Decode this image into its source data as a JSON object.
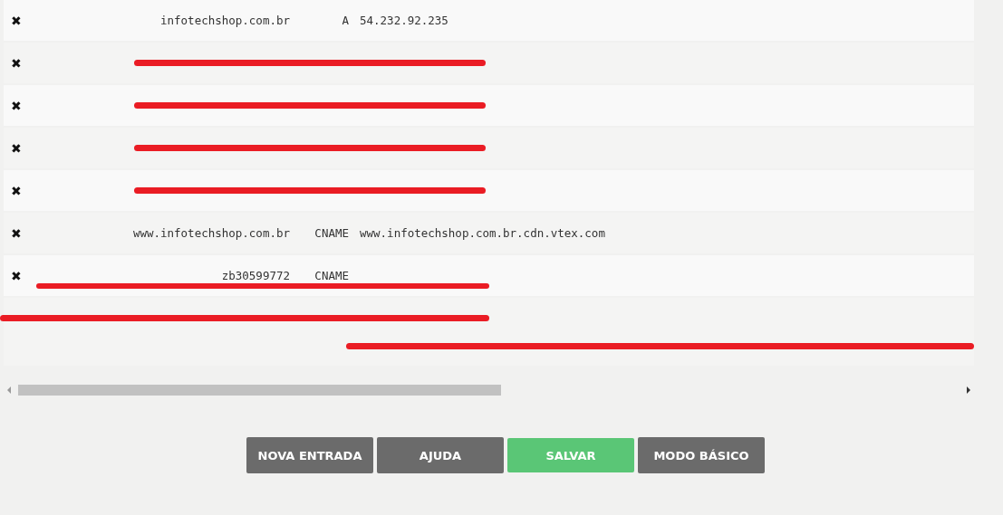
{
  "records": [
    {
      "delete_icon": "✖",
      "name": "infotechshop.com.br",
      "type": "A",
      "value": "54.232.92.235",
      "redacted": false
    },
    {
      "delete_icon": "✖",
      "redacted": true
    },
    {
      "delete_icon": "✖",
      "redacted": true
    },
    {
      "delete_icon": "✖",
      "redacted": true
    },
    {
      "delete_icon": "✖",
      "redacted": true
    },
    {
      "delete_icon": "✖",
      "name": "www.infotechshop.com.br",
      "type": "CNAME",
      "value": "www.infotechshop.com.br.cdn.vtex.com",
      "redacted": false
    },
    {
      "delete_icon": "✖",
      "name": "zb30599772",
      "type": "CNAME",
      "redacted": true
    },
    {
      "redacted": true,
      "wrapped": true
    }
  ],
  "buttons": [
    {
      "label": "NOVA ENTRADA",
      "kind": "neutral"
    },
    {
      "label": "AJUDA",
      "kind": "neutral"
    },
    {
      "label": "SALVAR",
      "kind": "primary"
    },
    {
      "label": "MODO BÁSICO",
      "kind": "neutral"
    }
  ]
}
